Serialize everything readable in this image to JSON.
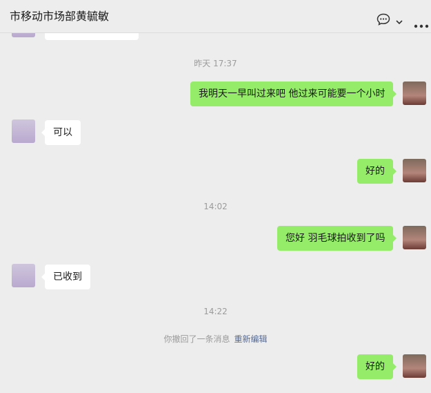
{
  "header": {
    "title": "市移动市场部黄毓敏"
  },
  "icons": {
    "chat": "chat-bubble-icon",
    "dropdown": "chevron-down-icon",
    "more": "more-dots-icon"
  },
  "colors": {
    "self_bubble": "#95ec69",
    "other_bubble": "#ffffff",
    "background": "#ededed",
    "link": "#576b95"
  },
  "messages": [
    {
      "side": "left",
      "text": ""
    },
    {
      "time": "昨天 17:37"
    },
    {
      "side": "right",
      "text": "我明天一早叫过来吧 他过来可能要一个小时"
    },
    {
      "side": "left",
      "text": "可以"
    },
    {
      "side": "right",
      "text": "好的"
    },
    {
      "time": "14:02"
    },
    {
      "side": "right",
      "text": "您好 羽毛球拍收到了吗"
    },
    {
      "side": "left",
      "text": "已收到"
    },
    {
      "time": "14:22"
    },
    {
      "recall": "你撤回了一条消息",
      "action": "重新编辑"
    },
    {
      "side": "right",
      "text": "好的"
    }
  ]
}
